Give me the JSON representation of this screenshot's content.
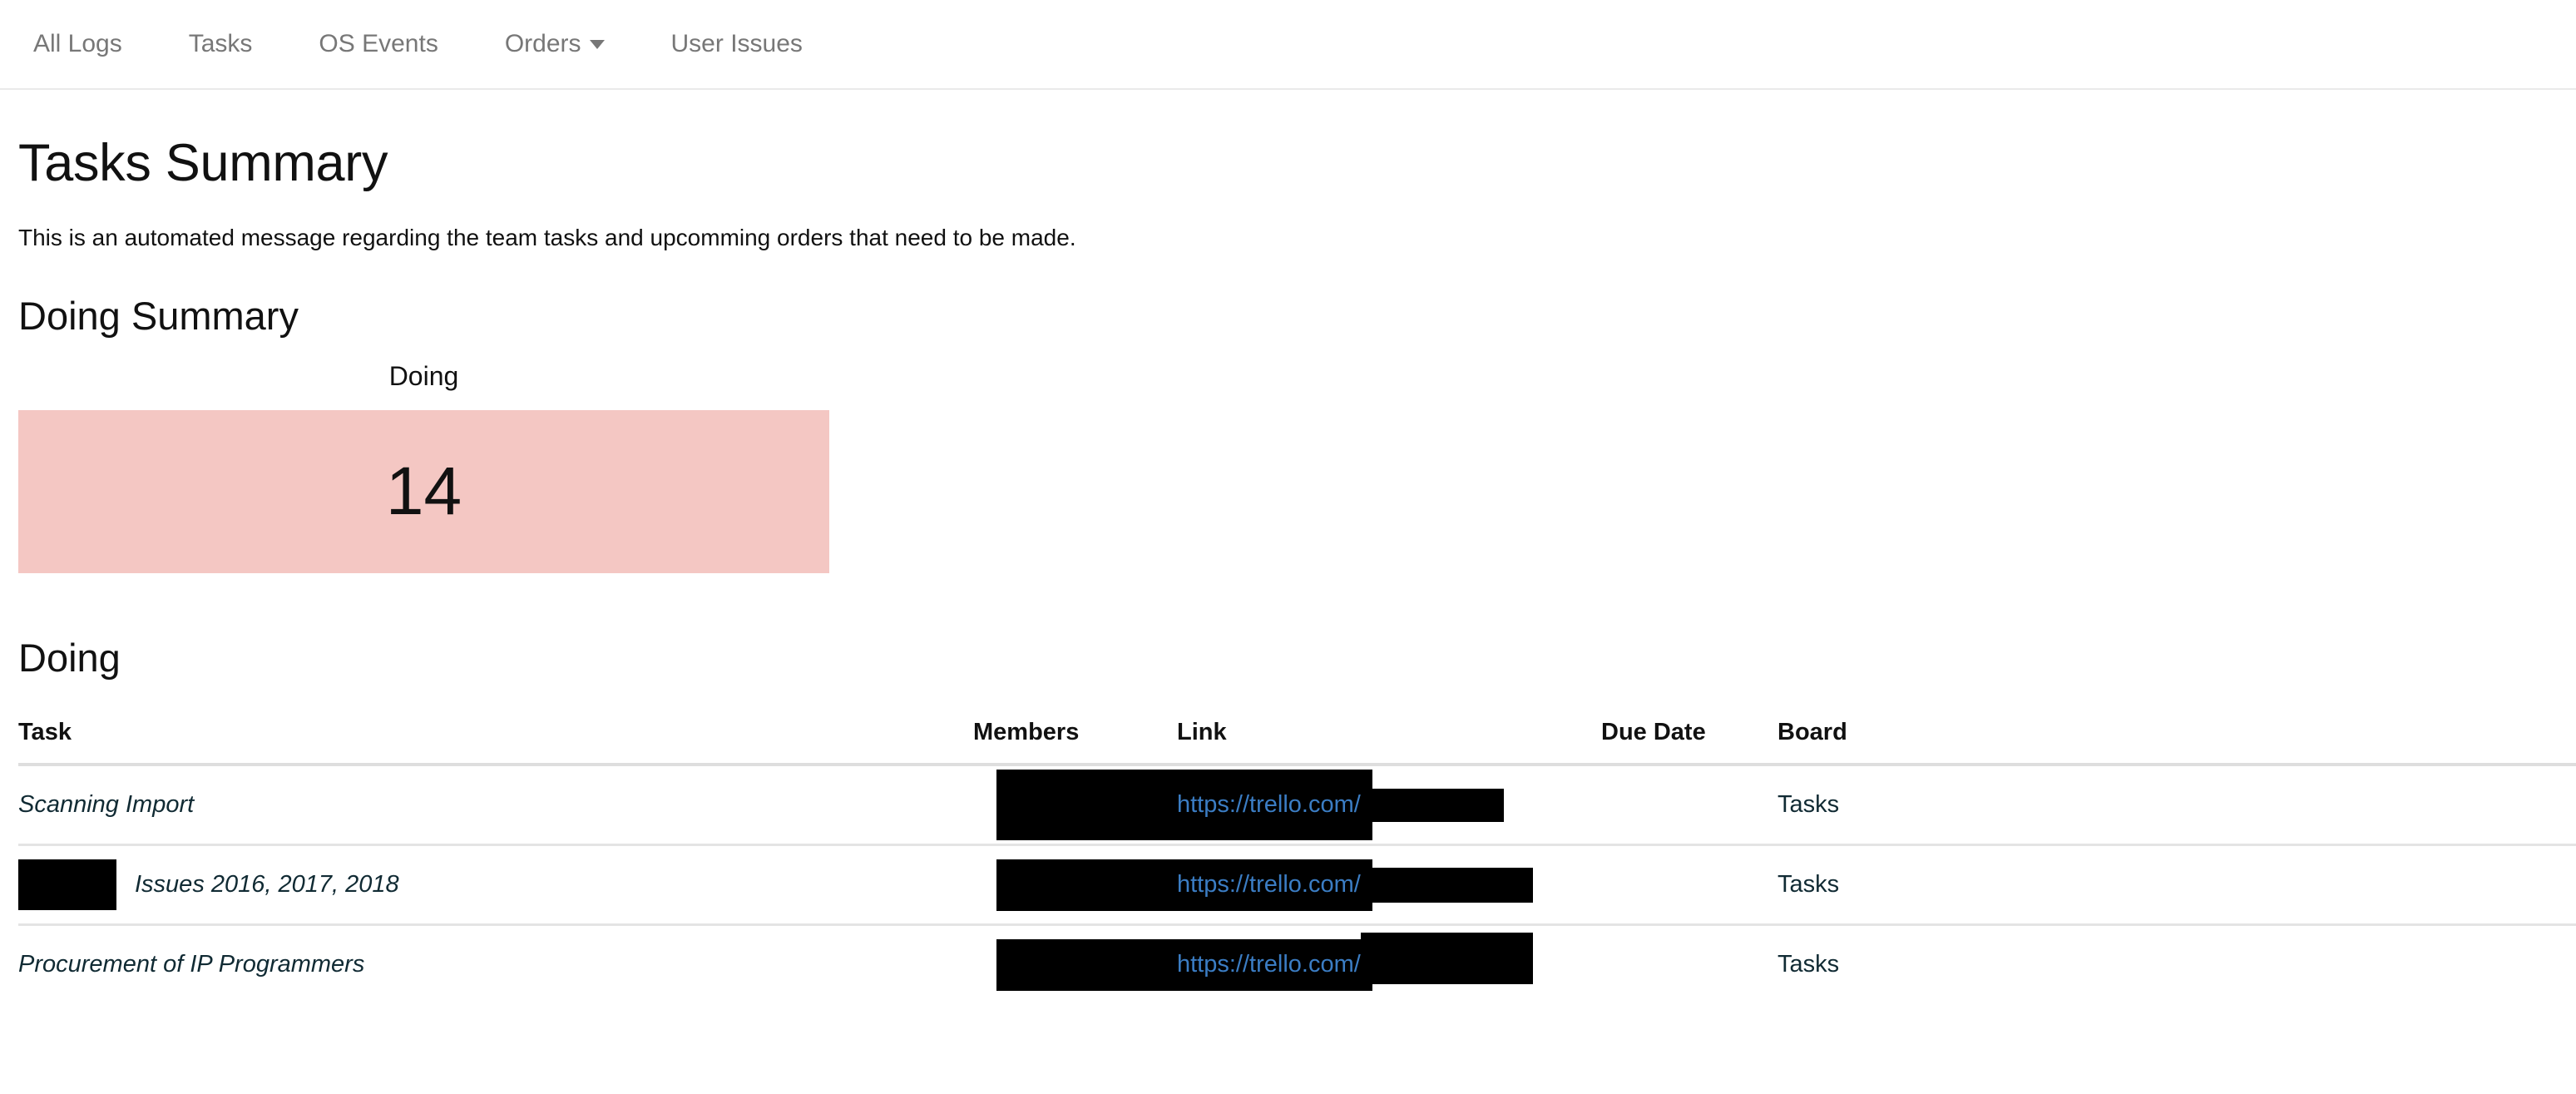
{
  "nav": {
    "items": [
      {
        "label": "All Logs",
        "has_caret": false
      },
      {
        "label": "Tasks",
        "has_caret": false
      },
      {
        "label": "OS Events",
        "has_caret": false
      },
      {
        "label": "Orders",
        "has_caret": true
      },
      {
        "label": "User Issues",
        "has_caret": false
      }
    ]
  },
  "page": {
    "title": "Tasks Summary",
    "subtitle": "This is an automated message regarding the team tasks and upcomming orders that need to be made.",
    "summary_section_heading": "Doing Summary",
    "table_section_heading": "Doing"
  },
  "summary_card": {
    "label": "Doing",
    "value": "14",
    "background_color": "#f4c7c3"
  },
  "table": {
    "headers": {
      "task": "Task",
      "members": "Members",
      "link": "Link",
      "due_date": "Due Date",
      "board": "Board"
    },
    "rows": [
      {
        "task": "Scanning Import",
        "task_redacted_prefix": false,
        "members": "",
        "members_redacted": true,
        "link_text": "https://trello.com/",
        "link_redacted": true,
        "due_date": "",
        "board": "Tasks"
      },
      {
        "task": "Issues 2016, 2017, 2018",
        "task_redacted_prefix": true,
        "members": "",
        "members_redacted": true,
        "link_text": "https://trello.com/",
        "link_redacted": true,
        "due_date": "",
        "board": "Tasks"
      },
      {
        "task": "Procurement of IP Programmers",
        "task_redacted_prefix": false,
        "members": "",
        "members_redacted": true,
        "link_text": "https://trello.com/",
        "link_redacted": true,
        "due_date": "",
        "board": "Tasks"
      }
    ]
  },
  "colors": {
    "nav_text": "#777777",
    "link_blue": "#3b7dc4",
    "card_pink": "#f4c7c3",
    "row_divider": "#e4e4e4",
    "header_divider": "#dedede"
  }
}
